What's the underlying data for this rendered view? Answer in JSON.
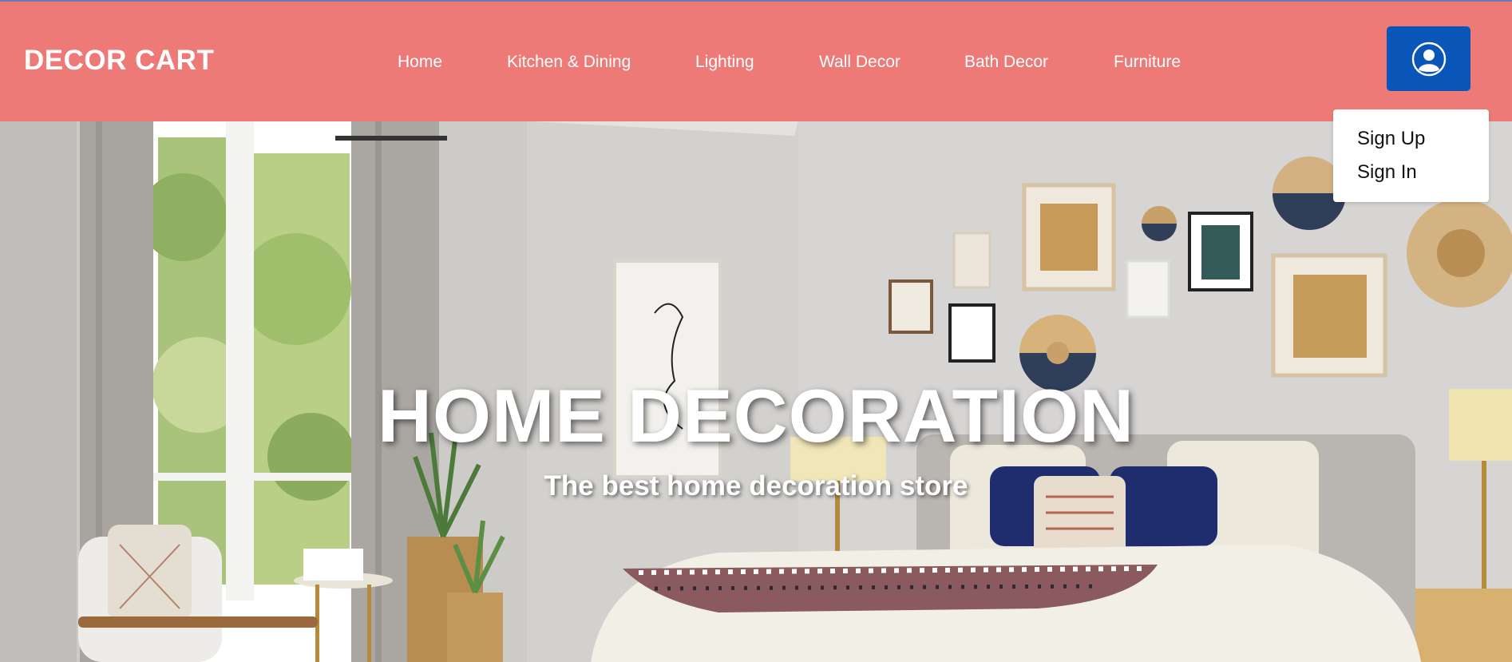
{
  "brand": {
    "name": "DECOR CART"
  },
  "nav": {
    "items": [
      {
        "label": "Home"
      },
      {
        "label": "Kitchen & Dining"
      },
      {
        "label": "Lighting"
      },
      {
        "label": "Wall Decor"
      },
      {
        "label": "Bath Decor"
      },
      {
        "label": "Furniture"
      }
    ]
  },
  "account": {
    "icon": "user-circle-icon",
    "menu": [
      {
        "label": "Sign Up"
      },
      {
        "label": "Sign In"
      }
    ]
  },
  "hero": {
    "title": "HOME DECORATION",
    "subtitle": "The best home decoration store"
  },
  "colors": {
    "navbar": "#ee7a77",
    "account_button": "#0a55b8",
    "text_light": "#ffffff"
  }
}
